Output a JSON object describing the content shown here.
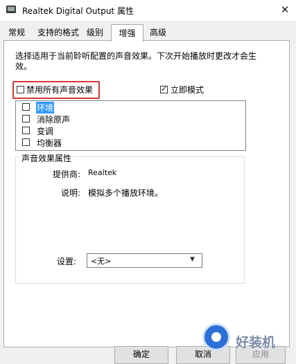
{
  "window": {
    "title": "Realtek Digital Output 属性",
    "close_glyph": "✕"
  },
  "tabs": [
    {
      "label": "常规"
    },
    {
      "label": "支持的格式"
    },
    {
      "label": "级别"
    },
    {
      "label": "增强",
      "active": true
    },
    {
      "label": "高级"
    }
  ],
  "enhancement": {
    "description": "选择适用于当前聆听配置的声音效果。下次开始播放时更改才会生效。",
    "disable_all_label": "禁用所有声音效果",
    "disable_all_checked": false,
    "immediate_mode_label": "立即模式",
    "immediate_mode_checked": true,
    "effects": [
      {
        "label": "环境",
        "checked": false,
        "selected": true
      },
      {
        "label": "消除原声",
        "checked": false
      },
      {
        "label": "变调",
        "checked": false
      },
      {
        "label": "均衡器",
        "checked": false
      }
    ]
  },
  "properties": {
    "group_title": "声音效果属性",
    "provider_label": "提供商:",
    "provider_value": "Realtek",
    "description_label": "说明:",
    "description_value": "模拟多个播放环境。",
    "setting_label": "设置:",
    "setting_value": "<无>"
  },
  "buttons": {
    "ok_label": "确定",
    "cancel_label": "取消",
    "apply_label": "应用"
  },
  "watermark": {
    "text": "好装机"
  },
  "colors": {
    "highlight": "#d23838",
    "selection": "#3399ff"
  }
}
